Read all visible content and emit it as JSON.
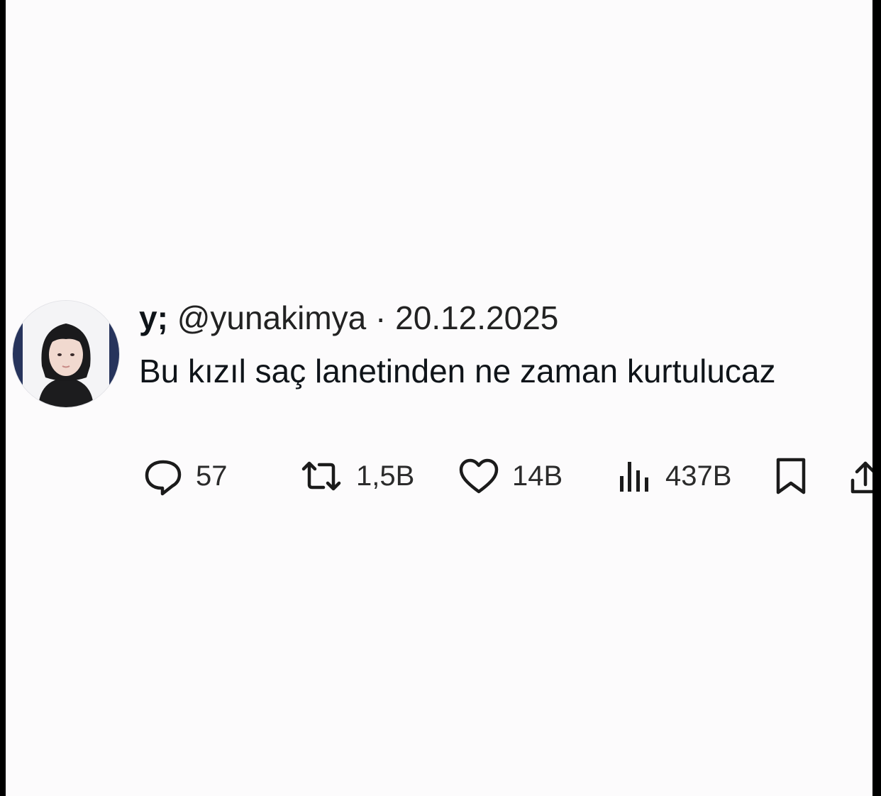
{
  "tweet": {
    "display_name": "y;",
    "handle": "@yunakimya",
    "separator": "·",
    "date": "20.12.2025",
    "text": "Bu kızıl saç lanetinden ne zaman kurtulucaz"
  },
  "actions": {
    "replies": "57",
    "reposts": "1,5B",
    "likes": "14B",
    "views": "437B"
  },
  "icons": {
    "reply": "speech-bubble-icon",
    "repost": "repost-arrows-icon",
    "like": "heart-icon",
    "views": "bar-chart-icon",
    "bookmark": "bookmark-icon",
    "share": "share-upload-icon"
  },
  "colors": {
    "background": "#fcfbfc",
    "text": "#0f1419",
    "border": "#000000"
  }
}
